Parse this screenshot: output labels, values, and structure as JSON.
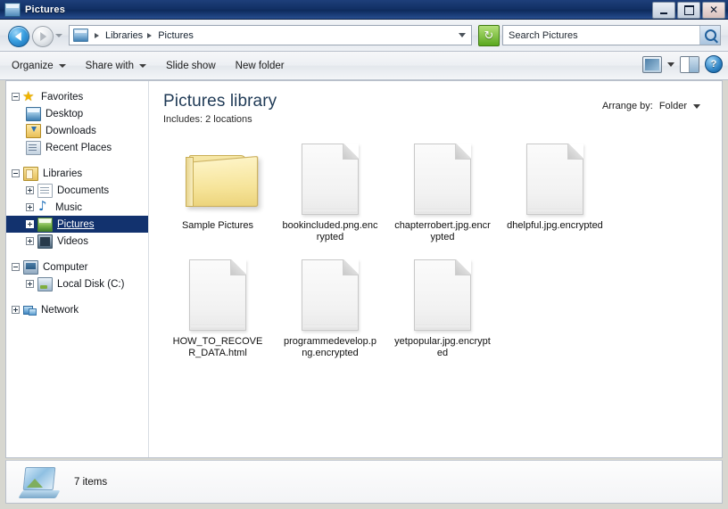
{
  "window": {
    "title": "Pictures",
    "icon": "pictures-library-icon",
    "buttons": {
      "minimize": "_",
      "maximize": "□",
      "close": "×"
    }
  },
  "addressbar": {
    "back_tooltip": "Back",
    "forward_tooltip": "Forward",
    "breadcrumbs": [
      "Libraries",
      "Pictures"
    ],
    "refresh_glyph": "↻",
    "search": {
      "placeholder": "Search Pictures",
      "value": ""
    }
  },
  "commandbar": {
    "items": [
      {
        "label": "Organize",
        "has_menu": true
      },
      {
        "label": "Share with",
        "has_menu": true
      },
      {
        "label": "Slide show",
        "has_menu": false
      },
      {
        "label": "New folder",
        "has_menu": false
      }
    ],
    "right_icons": [
      "change-view-icon",
      "view-dropdown-caret",
      "preview-pane-icon",
      "help-icon"
    ],
    "help_glyph": "?"
  },
  "sidebar": {
    "groups": [
      {
        "name": "Favorites",
        "expander": "minus",
        "icon": "star-icon",
        "items": [
          {
            "label": "Desktop",
            "icon": "desktop-icon",
            "expander": "none"
          },
          {
            "label": "Downloads",
            "icon": "downloads-icon",
            "expander": "none"
          },
          {
            "label": "Recent Places",
            "icon": "recent-places-icon",
            "expander": "none"
          }
        ]
      },
      {
        "name": "Libraries",
        "expander": "minus",
        "icon": "libraries-icon",
        "items": [
          {
            "label": "Documents",
            "icon": "documents-icon",
            "expander": "plus",
            "selected": false
          },
          {
            "label": "Music",
            "icon": "music-icon",
            "expander": "plus",
            "selected": false
          },
          {
            "label": "Pictures",
            "icon": "pictures-icon",
            "expander": "plus",
            "selected": true
          },
          {
            "label": "Videos",
            "icon": "videos-icon",
            "expander": "plus",
            "selected": false
          }
        ]
      },
      {
        "name": "Computer",
        "expander": "minus",
        "icon": "computer-icon",
        "items": [
          {
            "label": "Local Disk (C:)",
            "icon": "local-disk-icon",
            "expander": "plus"
          }
        ]
      },
      {
        "name": "Network",
        "expander": "plus",
        "icon": "network-icon",
        "items": []
      }
    ]
  },
  "library": {
    "title": "Pictures library",
    "subtitle": "Includes:  2 locations",
    "arrange_label": "Arrange by:",
    "arrange_value": "Folder"
  },
  "files": [
    {
      "name": "Sample Pictures",
      "type": "folder",
      "icon": "folder-icon"
    },
    {
      "name": "bookincluded.png.encrypted",
      "type": "file",
      "icon": "blank-document-icon"
    },
    {
      "name": "chapterrobert.jpg.encrypted",
      "type": "file",
      "icon": "blank-document-icon"
    },
    {
      "name": "dhelpful.jpg.encrypted",
      "type": "file",
      "icon": "blank-document-icon"
    },
    {
      "name": "HOW_TO_RECOVER_DATA.html",
      "type": "file",
      "icon": "blank-document-icon"
    },
    {
      "name": "programmedevelop.png.encrypted",
      "type": "file",
      "icon": "blank-document-icon"
    },
    {
      "name": "yetpopular.jpg.encrypted",
      "type": "file",
      "icon": "blank-document-icon"
    }
  ],
  "statusbar": {
    "icon": "pictures-library-large-icon",
    "text": "7 items"
  },
  "colors": {
    "titlebar": "#123166",
    "selection": "#12326e",
    "library_title": "#1f3a56",
    "refresh_green": "#5aa81e"
  }
}
